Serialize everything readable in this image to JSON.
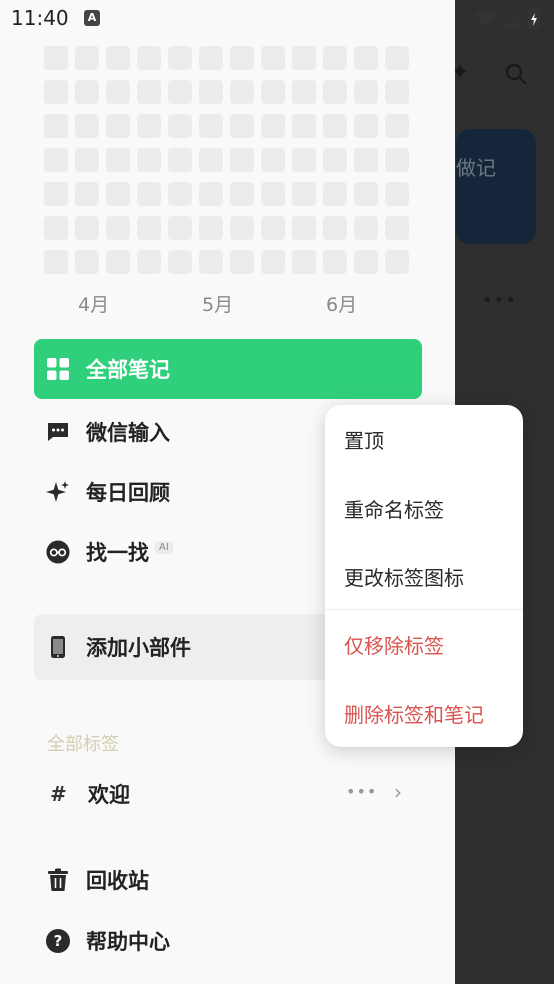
{
  "status_bar": {
    "time": "11:40",
    "notification_icon": "A"
  },
  "background_app": {
    "card_text": "做记"
  },
  "heatmap": {
    "months": [
      "4月",
      "5月",
      "6月"
    ],
    "highlighted_cell": {
      "row": 3,
      "col": 12
    }
  },
  "nav": {
    "all_notes": "全部笔记",
    "wechat_input": "微信输入",
    "daily_review": "每日回顾",
    "find": "找一找",
    "find_badge": "AI",
    "add_widget": "添加小部件"
  },
  "tags": {
    "section_title": "全部标签",
    "items": [
      {
        "label": "欢迎"
      }
    ]
  },
  "footer": {
    "trash": "回收站",
    "help": "帮助中心"
  },
  "context_menu": {
    "pin": "置顶",
    "rename": "重命名标签",
    "change_icon": "更改标签图标",
    "remove_tag_only": "仅移除标签",
    "delete_tag_and_notes": "删除标签和笔记"
  },
  "colors": {
    "accent": "#30cf7c",
    "danger": "#d9534f"
  }
}
